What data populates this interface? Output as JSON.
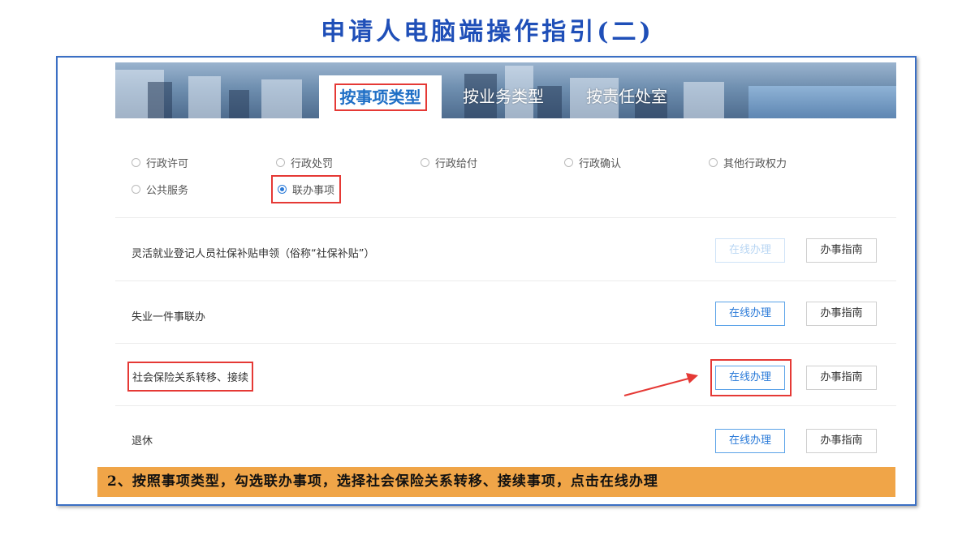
{
  "slide": {
    "title": "申请人电脑端操作指引(二)",
    "caption": "2、按照事项类型，勾选联办事项，选择社会保险关系转移、接续事项，点击在线办理"
  },
  "tabs": [
    {
      "label": "按事项类型",
      "active": true
    },
    {
      "label": "按业务类型",
      "active": false
    },
    {
      "label": "按责任处室",
      "active": false
    }
  ],
  "filters": [
    {
      "label": "行政许可",
      "checked": false
    },
    {
      "label": "行政处罚",
      "checked": false
    },
    {
      "label": "行政给付",
      "checked": false
    },
    {
      "label": "行政确认",
      "checked": false
    },
    {
      "label": "其他行政权力",
      "checked": false
    },
    {
      "label": "公共服务",
      "checked": false
    },
    {
      "label": "联办事项",
      "checked": true
    }
  ],
  "items": [
    {
      "name": "灵活就业登记人员社保补贴申领（俗称“社保补贴”）",
      "online_label": "在线办理",
      "online_enabled": false,
      "guide_label": "办事指南"
    },
    {
      "name": "失业一件事联办",
      "online_label": "在线办理",
      "online_enabled": true,
      "guide_label": "办事指南"
    },
    {
      "name": "社会保险关系转移、接续",
      "online_label": "在线办理",
      "online_enabled": true,
      "guide_label": "办事指南"
    },
    {
      "name": "退休",
      "online_label": "在线办理",
      "online_enabled": true,
      "guide_label": "办事指南"
    }
  ],
  "colors": {
    "title": "#1f4fb8",
    "accent": "#2a7ad8",
    "highlight": "#e53935",
    "caption_bg": "#f0a548"
  }
}
